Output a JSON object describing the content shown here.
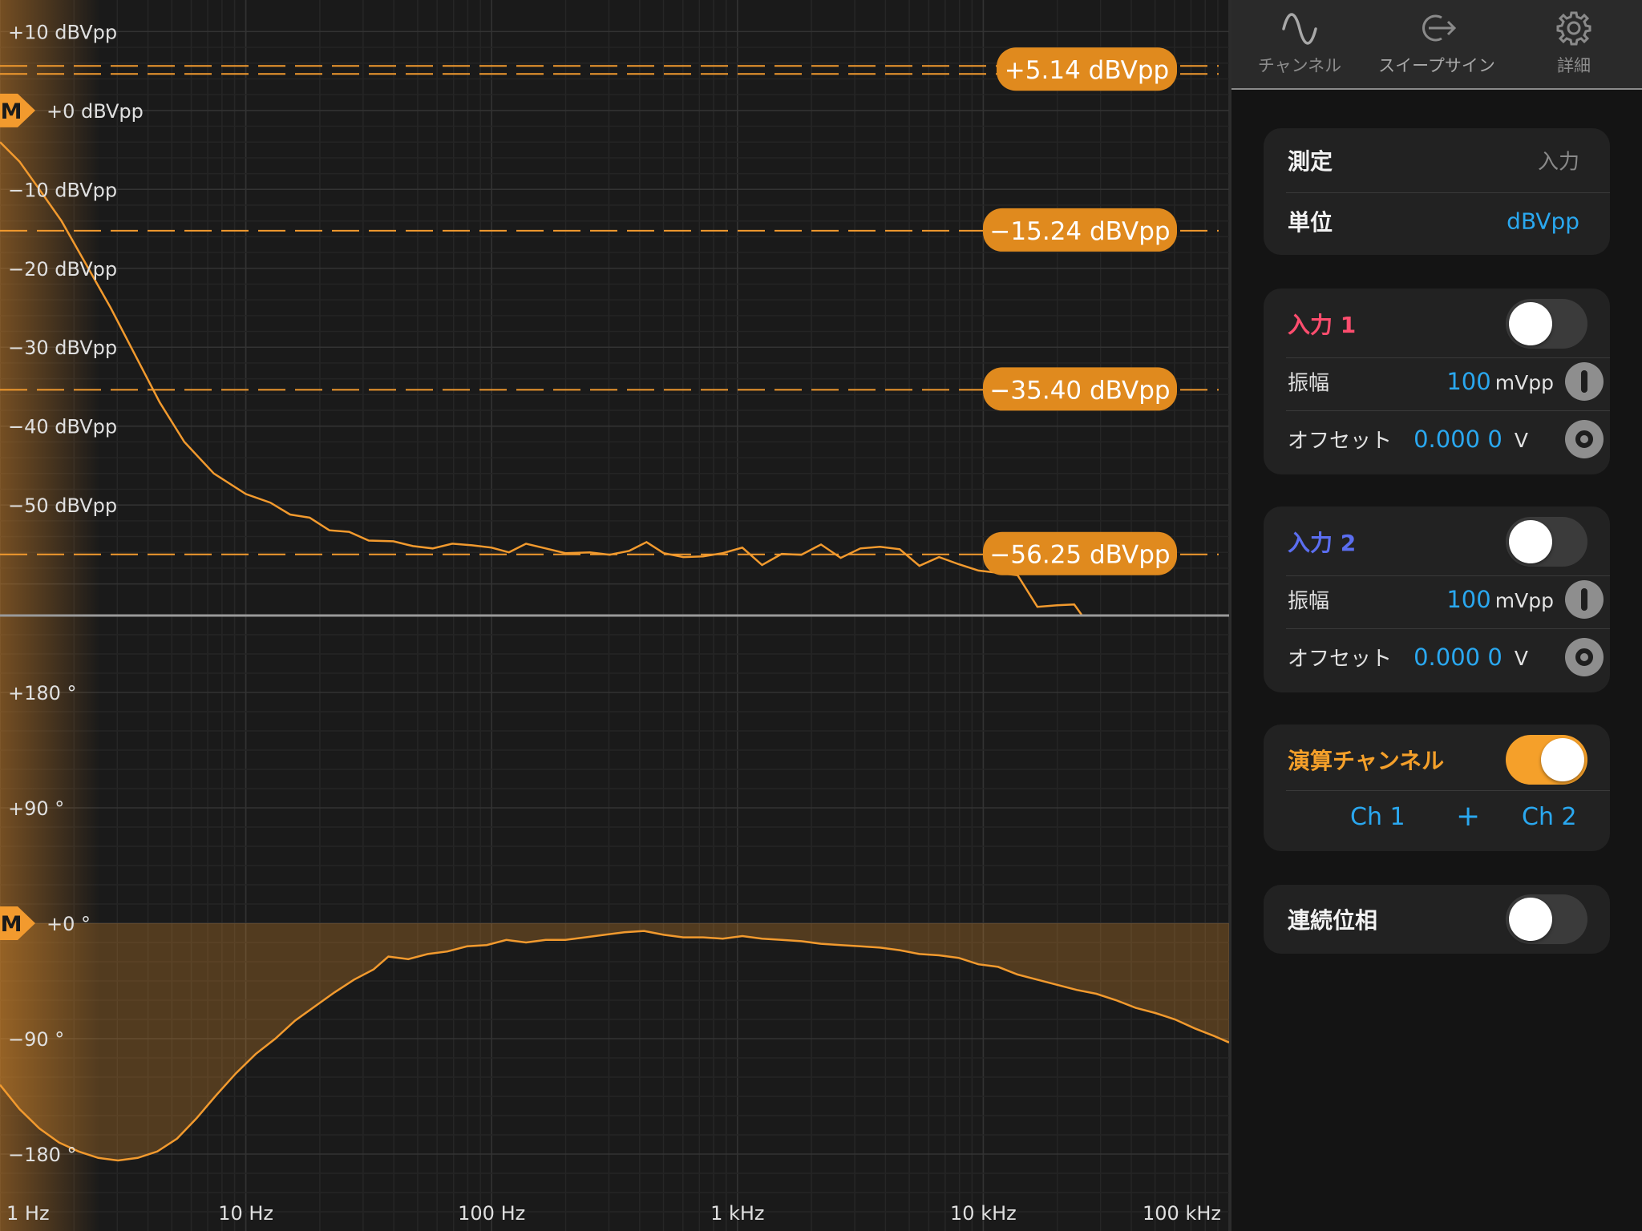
{
  "plot": {
    "colors": {
      "trace": "#f29a2e",
      "badge": "#e08a1e",
      "fill": "#f29a2e",
      "background": "#1a1a1a"
    },
    "x_labels": [
      "1 Hz",
      "10 Hz",
      "100 Hz",
      "1 kHz",
      "10 kHz",
      "100 kHz"
    ],
    "x_range_log10": [
      0,
      5
    ],
    "magnitude": {
      "y_labels": [
        "+10 dBVpp",
        "+0 dBVpp",
        "−10 dBVpp",
        "−20 dBVpp",
        "−30 dBVpp",
        "−40 dBVpp",
        "−50 dBVpp"
      ],
      "y_range": [
        -64,
        14
      ],
      "marker": "M",
      "measurements": [
        {
          "value": 5.14,
          "label": "+5.14 dBVpp"
        },
        {
          "value": -15.24,
          "label": "−15.24 dBVpp"
        },
        {
          "value": -35.4,
          "label": "−35.40 dBVpp"
        },
        {
          "value": -56.25,
          "label": "−56.25 dBVpp"
        }
      ],
      "trace": [
        [
          0.0,
          -4.0
        ],
        [
          0.08,
          -6.5
        ],
        [
          0.16,
          -10.0
        ],
        [
          0.25,
          -14.0
        ],
        [
          0.35,
          -19.5
        ],
        [
          0.45,
          -25.0
        ],
        [
          0.55,
          -31.0
        ],
        [
          0.65,
          -37.0
        ],
        [
          0.75,
          -42.0
        ],
        [
          0.87,
          -46.0
        ],
        [
          1.0,
          -48.6
        ],
        [
          1.1,
          -49.7
        ],
        [
          1.18,
          -51.2
        ],
        [
          1.26,
          -51.6
        ],
        [
          1.34,
          -53.2
        ],
        [
          1.42,
          -53.4
        ],
        [
          1.5,
          -54.5
        ],
        [
          1.6,
          -54.6
        ],
        [
          1.68,
          -55.2
        ],
        [
          1.76,
          -55.5
        ],
        [
          1.84,
          -54.9
        ],
        [
          1.92,
          -55.1
        ],
        [
          2.0,
          -55.4
        ],
        [
          2.07,
          -56.0
        ],
        [
          2.14,
          -54.9
        ],
        [
          2.22,
          -55.5
        ],
        [
          2.3,
          -56.1
        ],
        [
          2.4,
          -56.0
        ],
        [
          2.48,
          -56.3
        ],
        [
          2.56,
          -55.8
        ],
        [
          2.63,
          -54.7
        ],
        [
          2.7,
          -56.1
        ],
        [
          2.78,
          -56.6
        ],
        [
          2.86,
          -56.5
        ],
        [
          2.94,
          -56.1
        ],
        [
          3.02,
          -55.4
        ],
        [
          3.1,
          -57.6
        ],
        [
          3.18,
          -56.2
        ],
        [
          3.26,
          -56.3
        ],
        [
          3.34,
          -55.0
        ],
        [
          3.42,
          -56.7
        ],
        [
          3.5,
          -55.5
        ],
        [
          3.58,
          -55.3
        ],
        [
          3.66,
          -55.6
        ],
        [
          3.74,
          -57.7
        ],
        [
          3.82,
          -56.6
        ],
        [
          3.9,
          -57.5
        ],
        [
          3.98,
          -58.3
        ],
        [
          4.06,
          -58.6
        ],
        [
          4.14,
          -58.9
        ],
        [
          4.22,
          -62.9
        ],
        [
          4.3,
          -62.7
        ],
        [
          4.37,
          -62.6
        ],
        [
          4.4,
          -63.9
        ]
      ]
    },
    "phase": {
      "y_labels": [
        "+180 °",
        "+90 °",
        "+0 °",
        "−90 °",
        "−180 °"
      ],
      "y_range": [
        -240,
        240
      ],
      "marker": "M",
      "trace": [
        [
          0.0,
          -126
        ],
        [
          0.08,
          -145
        ],
        [
          0.16,
          -160
        ],
        [
          0.24,
          -171
        ],
        [
          0.32,
          -178
        ],
        [
          0.4,
          -183
        ],
        [
          0.48,
          -185
        ],
        [
          0.56,
          -183
        ],
        [
          0.64,
          -178
        ],
        [
          0.72,
          -168
        ],
        [
          0.8,
          -152
        ],
        [
          0.88,
          -134
        ],
        [
          0.96,
          -117
        ],
        [
          1.04,
          -102
        ],
        [
          1.12,
          -90
        ],
        [
          1.2,
          -76
        ],
        [
          1.28,
          -65
        ],
        [
          1.36,
          -54
        ],
        [
          1.44,
          -44
        ],
        [
          1.52,
          -36
        ],
        [
          1.58,
          -26
        ],
        [
          1.66,
          -28
        ],
        [
          1.74,
          -24
        ],
        [
          1.82,
          -22
        ],
        [
          1.9,
          -18
        ],
        [
          1.98,
          -17
        ],
        [
          2.06,
          -13
        ],
        [
          2.14,
          -15
        ],
        [
          2.22,
          -13
        ],
        [
          2.3,
          -13
        ],
        [
          2.38,
          -11
        ],
        [
          2.46,
          -9
        ],
        [
          2.54,
          -7
        ],
        [
          2.62,
          -6
        ],
        [
          2.7,
          -9
        ],
        [
          2.78,
          -11
        ],
        [
          2.86,
          -11
        ],
        [
          2.94,
          -12
        ],
        [
          3.02,
          -10
        ],
        [
          3.1,
          -12
        ],
        [
          3.18,
          -13
        ],
        [
          3.26,
          -14
        ],
        [
          3.34,
          -16
        ],
        [
          3.42,
          -17
        ],
        [
          3.5,
          -18
        ],
        [
          3.58,
          -19
        ],
        [
          3.66,
          -21
        ],
        [
          3.74,
          -24
        ],
        [
          3.82,
          -25
        ],
        [
          3.9,
          -27
        ],
        [
          3.98,
          -32
        ],
        [
          4.06,
          -34
        ],
        [
          4.14,
          -40
        ],
        [
          4.22,
          -44
        ],
        [
          4.3,
          -48
        ],
        [
          4.38,
          -52
        ],
        [
          4.46,
          -55
        ],
        [
          4.54,
          -60
        ],
        [
          4.62,
          -66
        ],
        [
          4.7,
          -70
        ],
        [
          4.78,
          -75
        ],
        [
          4.86,
          -82
        ],
        [
          4.94,
          -88
        ],
        [
          5.0,
          -93
        ]
      ]
    }
  },
  "tabs": [
    {
      "label": "チャンネル",
      "icon": "sine-wave-icon"
    },
    {
      "label": "スイープサイン",
      "icon": "sweep-arrow-icon"
    },
    {
      "label": "詳細",
      "icon": "gear-icon"
    }
  ],
  "measure_card": {
    "measure_label": "測定",
    "measure_value": "入力",
    "unit_label": "単位",
    "unit_value": "dBVpp"
  },
  "input1": {
    "title": "入力 1",
    "title_color": "#ff4d6e",
    "enabled": false,
    "amp_label": "振幅",
    "amp_value": "100",
    "amp_unit": "mVpp",
    "offset_label": "オフセット",
    "offset_value": "0.000 0",
    "offset_unit": "V"
  },
  "input2": {
    "title": "入力 2",
    "title_color": "#5b6ef0",
    "enabled": false,
    "amp_label": "振幅",
    "amp_value": "100",
    "amp_unit": "mVpp",
    "offset_label": "オフセット",
    "offset_value": "0.000 0",
    "offset_unit": "V"
  },
  "math_channel": {
    "title": "演算チャンネル",
    "title_color": "#f5a02a",
    "enabled": true,
    "ch_a": "Ch 1",
    "operator": "+",
    "ch_b": "Ch 2"
  },
  "continuous_phase": {
    "label": "連続位相",
    "enabled": false
  }
}
